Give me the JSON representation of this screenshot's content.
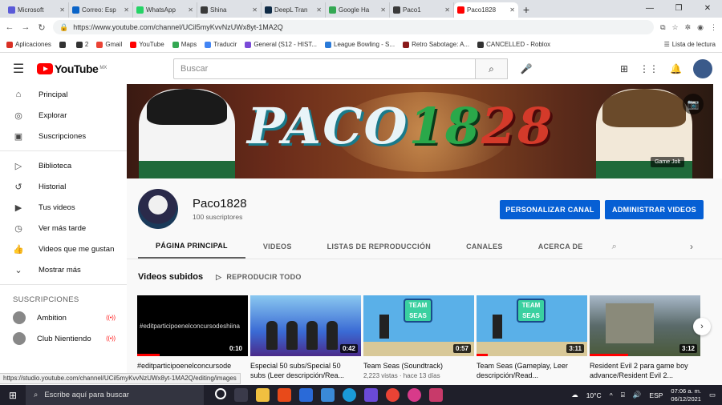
{
  "browser": {
    "tabs": [
      {
        "title": "Microsoft",
        "color": "#5a5ad8"
      },
      {
        "title": "Correo: Esp",
        "color": "#0a64c8"
      },
      {
        "title": "WhatsApp",
        "color": "#25d366"
      },
      {
        "title": "Shina",
        "color": "#3a3a3a"
      },
      {
        "title": "DeepL Tran",
        "color": "#0f2b46"
      },
      {
        "title": "Google Ha",
        "color": "#34a853"
      },
      {
        "title": "Paco1",
        "color": "#3a3a3a"
      },
      {
        "title": "Paco1828",
        "color": "#ff0000",
        "active": true
      }
    ],
    "new_tab": "+",
    "url": "https://www.youtube.com/channel/UCil5myKvvNzUWx8yt-1MA2Q",
    "bookmarks": [
      {
        "label": "Aplicaciones",
        "color": "#d93025"
      },
      {
        "label": "",
        "color": "#333"
      },
      {
        "label": "2",
        "color": "#333"
      },
      {
        "label": "Gmail",
        "color": "#ea4335"
      },
      {
        "label": "YouTube",
        "color": "#ff0000"
      },
      {
        "label": "Maps",
        "color": "#34a853"
      },
      {
        "label": "Traducir",
        "color": "#4285f4"
      },
      {
        "label": "General (S12 - HIST...",
        "color": "#7a4ad8"
      },
      {
        "label": "League Bowling - S...",
        "color": "#2a7ad8"
      },
      {
        "label": "Retro Sabotage: A...",
        "color": "#8a1a1a"
      },
      {
        "label": "CANCELLED - Roblox",
        "color": "#333"
      }
    ],
    "reading_list": "Lista de lectura"
  },
  "youtube": {
    "logo_text": "YouTube",
    "country": "MX",
    "search_placeholder": "Buscar",
    "sidebar": [
      {
        "label": "Principal",
        "icon": "home-icon",
        "glyph": "⌂"
      },
      {
        "label": "Explorar",
        "icon": "compass-icon",
        "glyph": "◎"
      },
      {
        "label": "Suscripciones",
        "icon": "subscriptions-icon",
        "glyph": "▣"
      },
      {
        "label": "Biblioteca",
        "icon": "library-icon",
        "glyph": "▷"
      },
      {
        "label": "Historial",
        "icon": "history-icon",
        "glyph": "↺"
      },
      {
        "label": "Tus videos",
        "icon": "your-videos-icon",
        "glyph": "▶"
      },
      {
        "label": "Ver más tarde",
        "icon": "watch-later-icon",
        "glyph": "◷"
      },
      {
        "label": "Videos que me gustan",
        "icon": "like-icon",
        "glyph": "👍"
      },
      {
        "label": "Mostrar más",
        "icon": "chevron-down-icon",
        "glyph": "⌄"
      }
    ],
    "subs_heading": "SUSCRIPCIONES",
    "subscriptions": [
      {
        "label": "Ambition",
        "live": "((•))"
      },
      {
        "label": "Club Nientiendo",
        "live": "((•))"
      }
    ],
    "channel": {
      "banner_title_1": "PACO",
      "banner_title_2": "18",
      "banner_title_3": "28",
      "banner_badge": "Game Jolt",
      "name": "Paco1828",
      "subscribers": "100 suscriptores",
      "customize_btn": "PERSONALIZAR CANAL",
      "manage_btn": "ADMINISTRAR VIDEOS",
      "tabs": [
        "PÁGINA PRINCIPAL",
        "VIDEOS",
        "LISTAS DE REPRODUCCIÓN",
        "CANALES",
        "ACERCA DE"
      ]
    },
    "videos_section": {
      "title": "Videos subidos",
      "play_all": "REPRODUCIR TODO",
      "videos": [
        {
          "title": "#editparticipoenelconcursode",
          "duration": "0:10",
          "meta": "",
          "thumb_text": "#editparticipoenelconcursodeshiina",
          "progress": 0.2
        },
        {
          "title": "Especial 50 subs/Special 50 subs (Leer descripción/Rea...",
          "duration": "0:42",
          "meta": "",
          "progress": 0.0
        },
        {
          "title": "Team Seas (Soundtrack)",
          "duration": "0:57",
          "meta": "2,223 vistas · hace 13 días",
          "thumb_text": "TEAM SEAS",
          "progress": 0.0
        },
        {
          "title": "Team Seas (Gameplay, Leer descripción/Read...",
          "duration": "3:11",
          "meta": "",
          "thumb_text": "TEAM SEAS",
          "progress": 0.1
        },
        {
          "title": "Resident Evil 2 para game boy advance/Resident Evil 2...",
          "duration": "3:12",
          "meta": "",
          "progress": 0.35
        }
      ]
    }
  },
  "status_url": "https://studio.youtube.com/channel/UCil5myKvvNzUWx8yt-1MA2Q/editing/images",
  "taskbar": {
    "search_placeholder": "Escribe aquí para buscar",
    "temperature": "10°C",
    "language": "ESP",
    "time": "07:06 a. m.",
    "date": "06/12/2021"
  }
}
